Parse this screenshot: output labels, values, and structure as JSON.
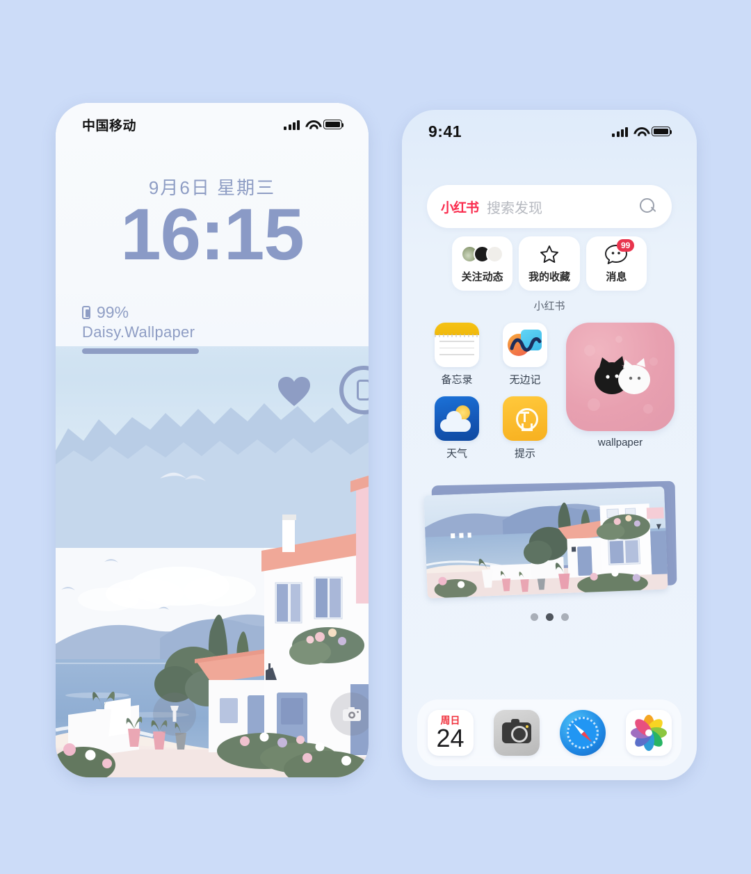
{
  "background_color": "#ccdcf8",
  "lock_screen": {
    "status_bar": {
      "carrier": "中国移动",
      "signal_icon": "signal-bars-icon",
      "wifi_icon": "wifi-icon",
      "battery_icon": "battery-full-icon"
    },
    "date": "9月6日 星期三",
    "time": "16:15",
    "battery_percent": "99%",
    "wallpaper_name": "Daisy.Wallpaper",
    "heart_icon": "heart-icon",
    "device_icon": "device-circle-icon",
    "flashlight_icon": "flashlight-icon",
    "camera_icon": "camera-icon",
    "text_color": "#8e9dc4"
  },
  "home_screen": {
    "status_bar": {
      "time": "9:41",
      "signal_icon": "signal-bars-icon",
      "wifi_icon": "wifi-icon",
      "battery_icon": "battery-full-icon"
    },
    "search": {
      "brand": "小红书",
      "placeholder": "搜索发现",
      "search_icon": "search-icon"
    },
    "tiles": [
      {
        "label": "关注动态",
        "icon": "avatars-icon"
      },
      {
        "label": "我的收藏",
        "icon": "star-icon"
      },
      {
        "label": "消息",
        "icon": "chat-bubble-icon",
        "badge": "99",
        "badge_color": "#e8344d"
      }
    ],
    "widget_label": "小红书",
    "apps": [
      {
        "label": "备忘录",
        "icon": "notes-icon"
      },
      {
        "label": "无边记",
        "icon": "freeform-icon"
      },
      {
        "label": "天气",
        "icon": "weather-icon"
      },
      {
        "label": "提示",
        "icon": "tips-icon"
      }
    ],
    "wallpaper_widget": {
      "label": "wallpaper",
      "icon": "cats-photo-icon"
    },
    "photo_stack": {
      "icon": "photo-stack-widget"
    },
    "page_dots": {
      "count": 3,
      "active_index": 1
    },
    "dock": [
      {
        "label": "日历",
        "icon": "calendar-icon",
        "weekday": "周日",
        "day": "24"
      },
      {
        "label": "相机",
        "icon": "camera-icon"
      },
      {
        "label": "Safari",
        "icon": "safari-icon"
      },
      {
        "label": "照片",
        "icon": "photos-icon"
      }
    ]
  }
}
